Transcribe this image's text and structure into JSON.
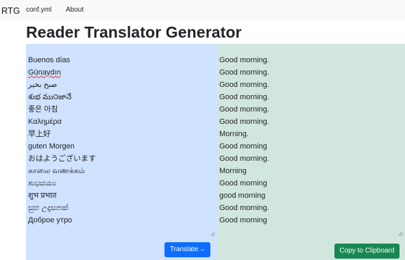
{
  "navbar": {
    "brand": "RTG",
    "links": [
      "conf.yml",
      "About"
    ]
  },
  "page_title": "Reader Translator Generator",
  "source_lines": [
    "Buenos días",
    "Günaydın",
    "صبح بخیر",
    "శుభ ము౦జానే",
    "좋은 아침",
    "Καλημέρα",
    "早上好",
    "guten Morgen",
    "おはようございます",
    "காலை வணக்கம்",
    "ಶುಭದಯಂ",
    "शुभ प्रभात",
    "සුභ උදෑසනක්",
    "Доброе утро"
  ],
  "translated_lines": [
    "Good morning.",
    "Good morning.",
    "Good morning.",
    "Good morning.",
    "Good morning.",
    "Good morning.",
    "Morning.",
    "Good morning",
    "Good morning.",
    "Morning",
    "Good morning",
    "good morning",
    "Good morning.",
    "Good morning"
  ],
  "buttons": {
    "translate": "Translate→",
    "copy": "Copy to Clipboard"
  },
  "colors": {
    "source_bg": "#cfe2ff",
    "output_bg": "#d1e7dd",
    "translate_button": "#0d6efd",
    "copy_button": "#198754"
  }
}
